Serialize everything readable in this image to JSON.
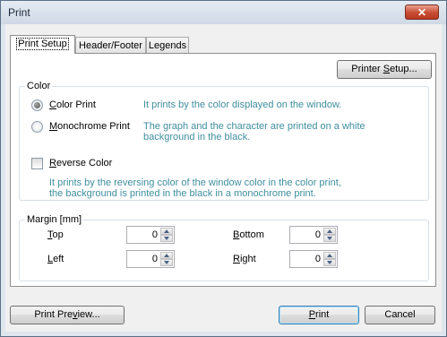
{
  "window": {
    "title": "Print",
    "close_glyph": "✕"
  },
  "tabs": [
    {
      "label": "Print Setup",
      "active": true
    },
    {
      "label": "Header/Footer",
      "active": false
    },
    {
      "label": "Legends",
      "active": false
    }
  ],
  "printer_setup": {
    "pre": "Printer ",
    "mnemonic": "S",
    "post": "etup..."
  },
  "color_group": {
    "label": "Color",
    "color_print": {
      "mnemonic": "C",
      "rest": "olor Print",
      "checked": true,
      "desc": "It prints by the color displayed on the window."
    },
    "mono_print": {
      "mnemonic": "M",
      "rest": "onochrome Print",
      "checked": false,
      "desc_line1": "The graph and the character are printed on a white",
      "desc_line2": "background in the black."
    },
    "reverse_color": {
      "mnemonic": "R",
      "rest": "everse Color",
      "checked": false,
      "desc_line1": "It prints by the reversing color of the window color in the color print,",
      "desc_line2": "the background is printed in the black in a monochrome print."
    }
  },
  "margin_group": {
    "label": "Margin [mm]",
    "top": {
      "mnemonic": "T",
      "rest": "op",
      "value": "0"
    },
    "left": {
      "mnemonic": "L",
      "rest": "eft",
      "value": "0"
    },
    "bottom": {
      "mnemonic": "B",
      "rest": "ottom",
      "value": "0"
    },
    "right": {
      "mnemonic": "R",
      "rest": "ight",
      "value": "0"
    }
  },
  "buttons": {
    "preview": {
      "pre": "Print Pre",
      "mnemonic": "v",
      "post": "iew..."
    },
    "print": {
      "pre": "",
      "mnemonic": "P",
      "post": "rint"
    },
    "cancel": "Cancel"
  },
  "colors": {
    "description_text": "#3f8e9e",
    "close_button": "#c74a32",
    "titlebar": "#d6dfe9"
  },
  "icons": {
    "close": "close-icon",
    "spin_up": "arrow-up-icon",
    "spin_down": "arrow-down-icon"
  }
}
